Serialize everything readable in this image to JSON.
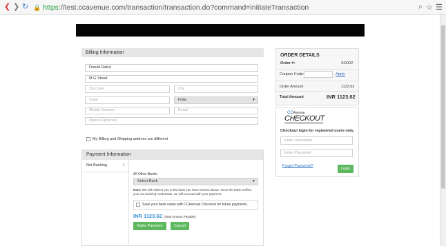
{
  "browser": {
    "url_scheme": "https",
    "url_rest": "://test.ccavenue.com/transaction/transaction.do?command=initiateTransaction",
    "back_glyph": "❮",
    "forward_glyph": "❯",
    "reload_glyph": "↻"
  },
  "billing": {
    "title": "Billing Information",
    "name_value": "Dravid Rahul",
    "address_value": "M G Street",
    "zip_placeholder": "Zip Code",
    "city_placeholder": "City",
    "state_placeholder": "State",
    "country_value": "India",
    "mobile_placeholder": "Mobile Number",
    "email_placeholder": "Email",
    "notes_placeholder": "Notes (Optional)",
    "shipping_diff_label": "My Billing and Shipping address are different"
  },
  "payment": {
    "title": "Payment Information",
    "tab_net_banking": "Net Banking",
    "tab_arrow": "›",
    "all_other_banks_label": "All Other Banks",
    "select_bank_value": "Select Bank",
    "note_bold": "Note:",
    "note_text": " We will redirect you to the bank you have chosen above. Once the bank verifies your net banking credentials, we will proceed with your payment.",
    "save_bank_label": "Save your bank name with CCAvenue Checkout for future payments.",
    "amount": "INR 1123.62",
    "amount_note": "(Total Amount Payable)",
    "make_payment_label": "Make Payment",
    "cancel_label": "Cancel"
  },
  "order": {
    "title": "ORDER DETAILS",
    "order_no_label": "Order #:",
    "order_no_value": "SO002",
    "coupon_label": "Coupon Code:",
    "apply_label": "Apply",
    "order_amount_label": "Order Amount",
    "order_amount_value": "1123.62",
    "total_label": "Total Amount",
    "total_value": "INR 1123.62"
  },
  "checkout": {
    "logo_cc": "CC",
    "logo_avenue": "Avenue",
    "logo_checkout": "CHECKOUT",
    "login_heading": "Checkout login for registered users only.",
    "username_placeholder": "Enter Username",
    "password_placeholder": "Enter Password",
    "forgot_label": "Forgot Password?",
    "login_label": "Login"
  }
}
